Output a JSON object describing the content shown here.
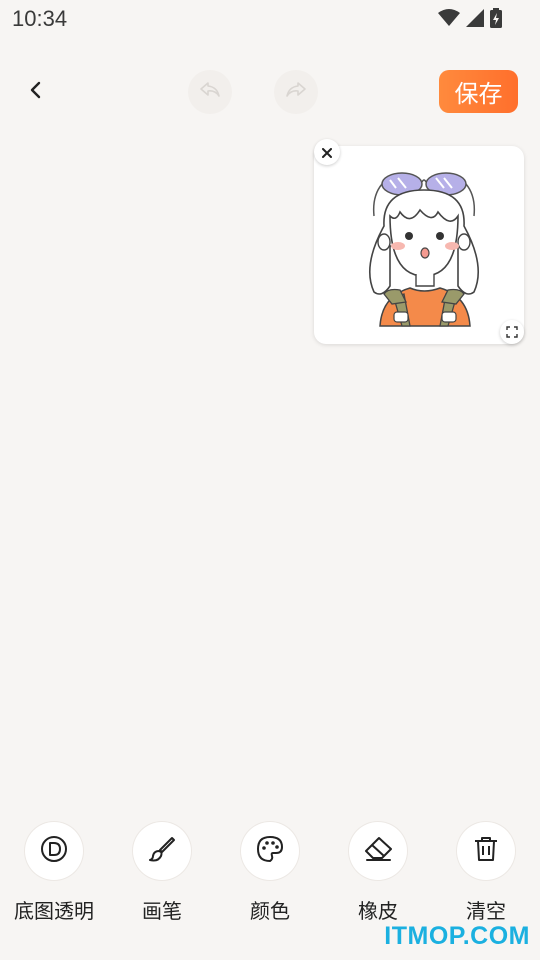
{
  "status_bar": {
    "time": "10:34",
    "icons": [
      "wifi-icon",
      "signal-icon",
      "battery-icon"
    ]
  },
  "top_bar": {
    "save_label": "保存"
  },
  "tools": [
    {
      "icon": "transparent-base-icon",
      "label": "底图透明"
    },
    {
      "icon": "brush-icon",
      "label": "画笔"
    },
    {
      "icon": "palette-icon",
      "label": "颜色"
    },
    {
      "icon": "eraser-icon",
      "label": "橡皮"
    },
    {
      "icon": "trash-icon",
      "label": "清空"
    }
  ],
  "watermark": "ITMOP.COM",
  "colors": {
    "accent": "#ff7a32",
    "background": "#f7f5f3",
    "watermark": "#1bb0e0"
  }
}
